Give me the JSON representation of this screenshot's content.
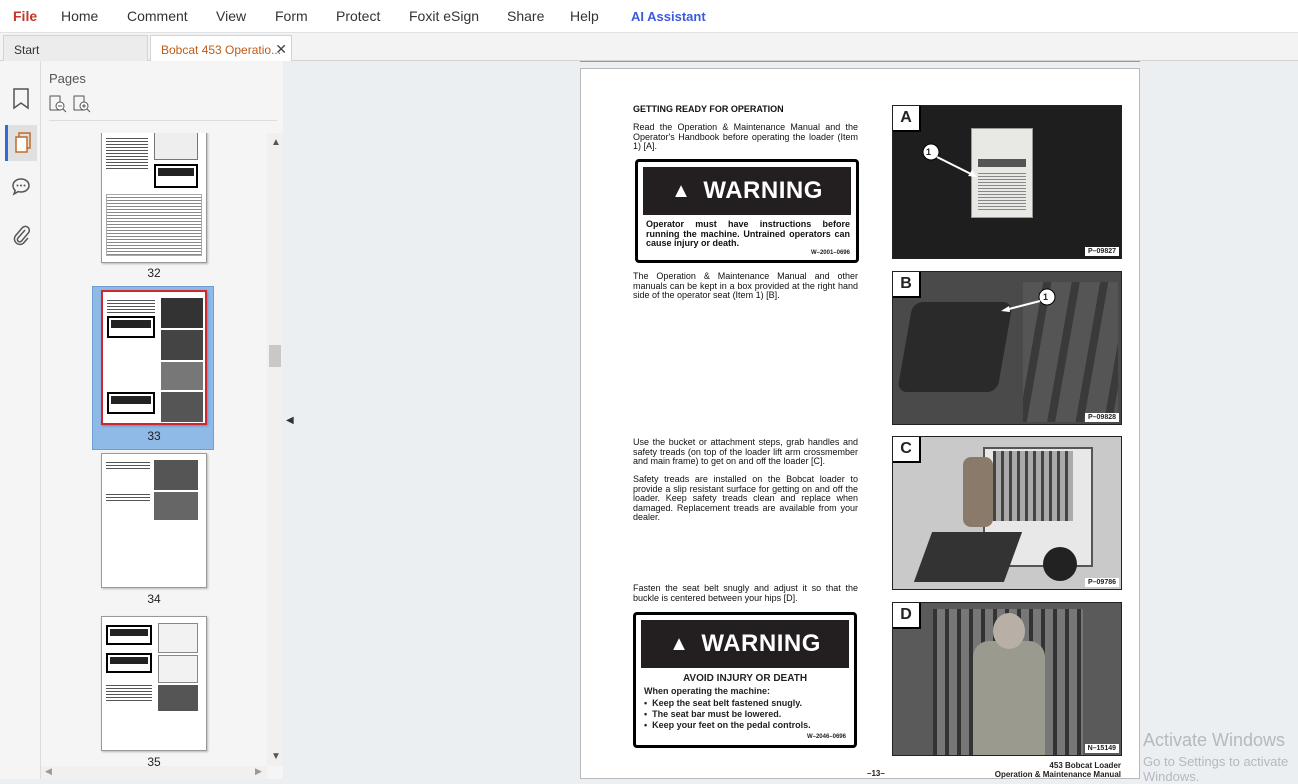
{
  "menu": [
    "File",
    "Home",
    "Comment",
    "View",
    "Form",
    "Protect",
    "Foxit eSign",
    "Share",
    "Help",
    "AI Assistant"
  ],
  "colors": {
    "file": "#c0392b",
    "ai": "#3b5bdb",
    "accent": "#2f6bd9"
  },
  "tabs": {
    "start": "Start",
    "doc": "Bobcat 453 Operatio...",
    "close": "✕"
  },
  "left_icons": [
    "bookmark-icon",
    "pages-icon",
    "comment-icon",
    "attachment-icon"
  ],
  "panel": {
    "title": "Pages"
  },
  "thumbs": [
    {
      "num": "32"
    },
    {
      "num": "33",
      "selected": true
    },
    {
      "num": "34"
    },
    {
      "num": "35"
    }
  ],
  "doc": {
    "heading": "GETTING READY FOR OPERATION",
    "p1": "Read the Operation & Maintenance Manual and the Operator's Handbook before operating the loader (Item 1) [A].",
    "warn1": {
      "title": "WARNING",
      "body": "Operator must have instructions before running the machine. Untrained operators can cause injury or death.",
      "code": "W–2001–0696"
    },
    "p2": "The Operation & Maintenance Manual and other manuals can be kept in a box provided at the right hand side of the operator seat (Item 1) [B].",
    "p3": "Use the bucket or attachment steps, grab handles and safety treads (on top of the loader lift arm crossmember and main frame) to get on and off the loader [C].",
    "p4": "Safety treads are installed on the Bobcat loader to provide a slip resistant surface for getting on and off the loader. Keep safety treads clean and replace when damaged. Replacement treads are available from your dealer.",
    "p5": "Fasten the seat belt snugly and adjust it so that the buckle is centered between your hips [D].",
    "warn2": {
      "title": "WARNING",
      "sub": "AVOID INJURY OR DEATH",
      "lead": "When operating the machine:",
      "items": [
        "Keep the seat belt fastened snugly.",
        "The seat bar must be lowered.",
        "Keep your feet on the pedal controls."
      ],
      "code": "W–2046–0696"
    },
    "photos": [
      {
        "label": "A",
        "code": "P–09827",
        "callout": "1"
      },
      {
        "label": "B",
        "code": "P–09828",
        "callout": "1"
      },
      {
        "label": "C",
        "code": "P–09786"
      },
      {
        "label": "D",
        "code": "N–15149"
      }
    ],
    "page_num": "–13–",
    "footer1": "453 Bobcat Loader",
    "footer2": "Operation & Maintenance Manual"
  },
  "watermark": {
    "line1": "Activate Windows",
    "line2": "Go to Settings to activate Windows."
  }
}
